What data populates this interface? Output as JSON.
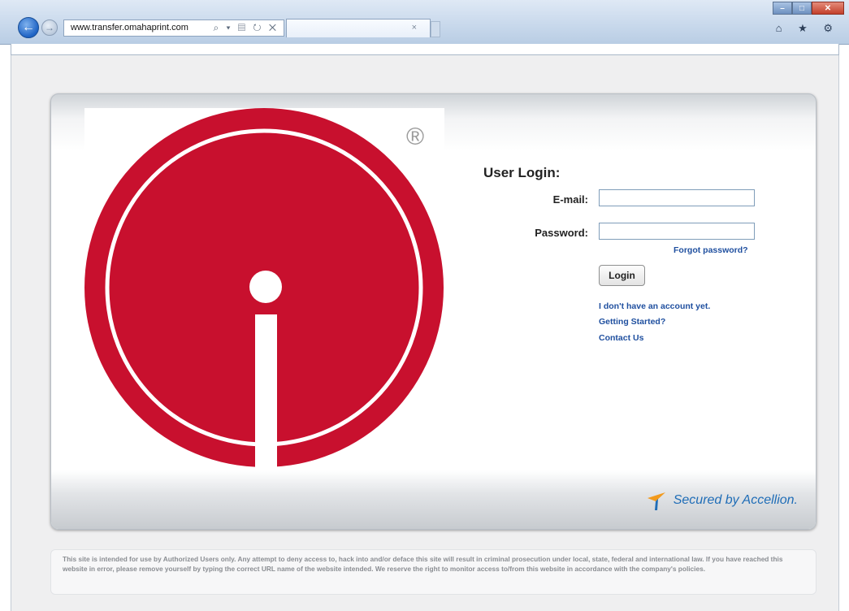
{
  "browser": {
    "url": "www.transfer.omahaprint.com",
    "address_icons": "⌕ ▾ ▤ ↻ ✕",
    "tab_close": "×",
    "right_icons": "⌂ ★ ⚙",
    "window_controls": {
      "minimize": "–",
      "maximize": "□",
      "close": "✕"
    }
  },
  "logo": {
    "registered_mark": "®",
    "brand_color": "#c8102e"
  },
  "login": {
    "title": "User Login:",
    "email_label": "E-mail:",
    "email_value": "",
    "password_label": "Password:",
    "password_value": "",
    "forgot_link": "Forgot password?",
    "login_button": "Login",
    "no_account_link": "I don't have an account yet.",
    "getting_started_link": "Getting Started?",
    "contact_link": "Contact Us"
  },
  "footer": {
    "secured_by": "Secured by Accellion."
  },
  "disclaimer": "This site is intended for use by Authorized Users only. Any attempt to deny access to, hack into and/or deface this site will result in criminal prosecution under local, state, federal and international law. If you have reached this website in error, please remove yourself by typing the correct URL name of the website intended. We reserve the right to monitor access to/from this website in accordance with the company's policies.",
  "colors": {
    "link": "#1f4f9f",
    "accellion_blue": "#1f6db7",
    "accellion_orange": "#f29a1d"
  },
  "icons": [
    "back-arrow-icon",
    "forward-arrow-icon",
    "search-icon",
    "refresh-icon",
    "stop-icon",
    "home-icon",
    "favorites-star-icon",
    "settings-gear-icon",
    "accellion-logo-icon"
  ]
}
